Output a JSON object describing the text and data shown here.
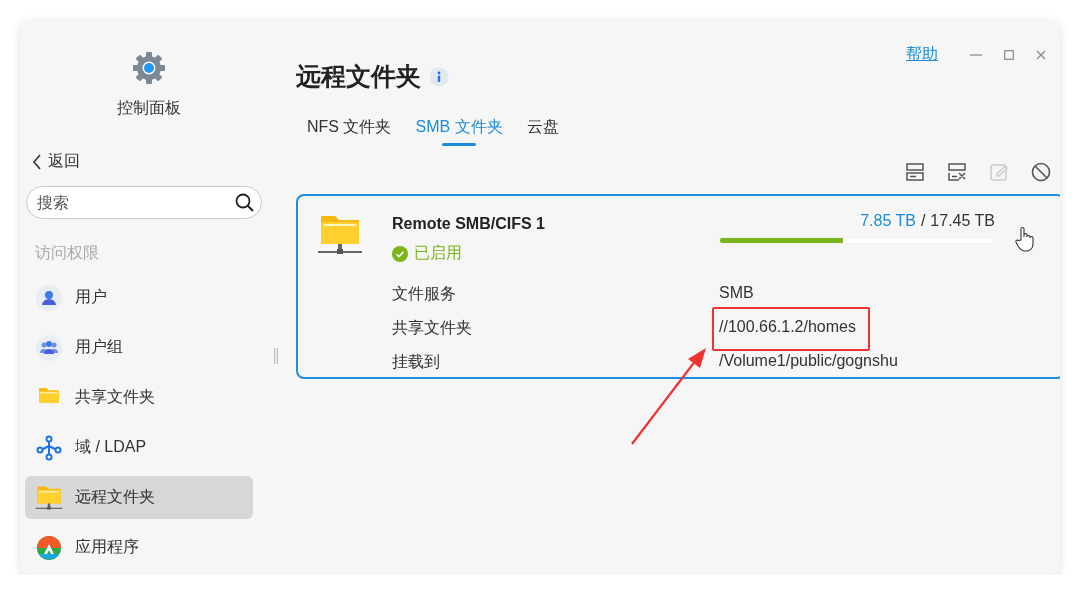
{
  "window": {
    "help_link": "帮助"
  },
  "sidebar": {
    "app_title": "控制面板",
    "back": "返回",
    "search": {
      "placeholder": "搜索"
    },
    "section": "访问权限",
    "items": [
      {
        "label": "用户",
        "kind": "user",
        "selected": false
      },
      {
        "label": "用户组",
        "kind": "group",
        "selected": false
      },
      {
        "label": "共享文件夹",
        "kind": "folder",
        "selected": false
      },
      {
        "label": "域 / LDAP",
        "kind": "ldap",
        "selected": false
      },
      {
        "label": "远程文件夹",
        "kind": "remote-folder",
        "selected": true
      },
      {
        "label": "应用程序",
        "kind": "apps",
        "selected": false
      }
    ]
  },
  "main": {
    "title": "远程文件夹",
    "tabs": [
      {
        "label": "NFS 文件夹",
        "selected": false
      },
      {
        "label": "SMB 文件夹",
        "selected": true
      },
      {
        "label": "云盘",
        "selected": false
      }
    ],
    "card": {
      "name": "Remote SMB/CIFS 1",
      "status": "已启用",
      "enabled": true,
      "selected": true,
      "usage": {
        "used": "7.85 TB",
        "separator": "/",
        "total": "17.45 TB",
        "level": 0.45
      },
      "details": [
        {
          "label": "文件服务",
          "value": "SMB",
          "highlighted": false
        },
        {
          "label": "共享文件夹",
          "value": "//100.66.1.2/homes",
          "highlighted": true
        },
        {
          "label": "挂载到",
          "value": "/Volume1/public/gognshu",
          "highlighted": false
        }
      ]
    }
  }
}
